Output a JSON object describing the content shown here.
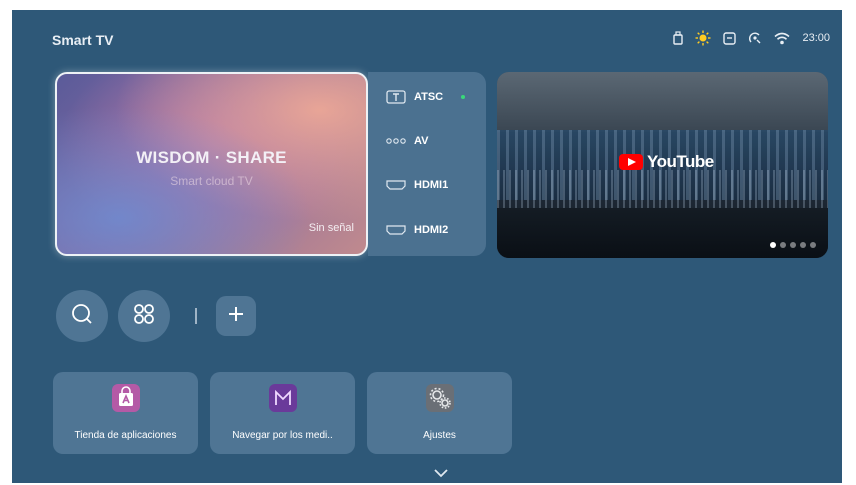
{
  "topbar": {
    "title": "Smart TV",
    "time": "23:00"
  },
  "hero": {
    "title": "WISDOM · SHARE",
    "subtitle": "Smart cloud TV",
    "signal": "Sin señal"
  },
  "sources": [
    {
      "label": "ATSC",
      "icon": "tv-tuner-icon"
    },
    {
      "label": "AV",
      "icon": "av-dots-icon"
    },
    {
      "label": "HDMI1",
      "icon": "hdmi-port-icon"
    },
    {
      "label": "HDMI2",
      "icon": "hdmi-port-icon"
    }
  ],
  "featured": {
    "brand": "YouTube",
    "slides": 5,
    "active_slide": 1
  },
  "quick_actions": {
    "search": "search-icon",
    "apps": "apps-grid-icon",
    "add": "plus-icon"
  },
  "apps": [
    {
      "label": "Tienda de aplicaciones",
      "icon": "app-store-icon",
      "color": "#b45aa6"
    },
    {
      "label": "Navegar por los medi..",
      "icon": "media-browser-icon",
      "color": "#6a3a9a"
    },
    {
      "label": "Ajustes",
      "icon": "settings-gear-icon",
      "color": "#6a6f76"
    }
  ],
  "colors": {
    "background": "#2e5878",
    "panel": "#4b7190",
    "accent": "#39d97a"
  }
}
